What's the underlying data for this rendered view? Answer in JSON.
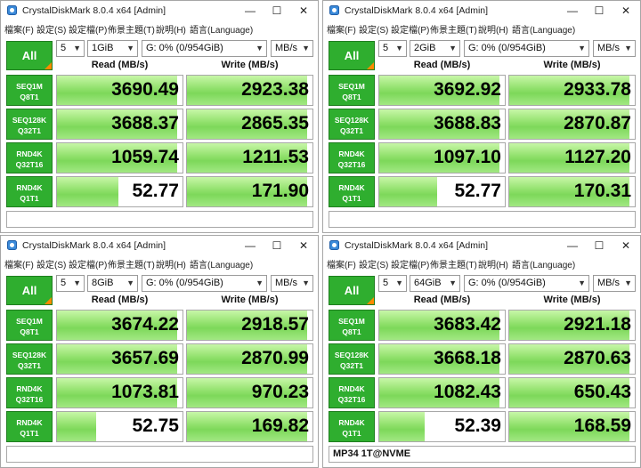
{
  "app_title": "CrystalDiskMark 8.0.4 x64 [Admin]",
  "menu": [
    "檔案(F)",
    "設定(S)",
    "設定檔(P)",
    "佈景主題(T)",
    "說明(H)",
    "語言(Language)"
  ],
  "window_controls": {
    "minimize": "—",
    "maximize": "☐",
    "close": "✕"
  },
  "all_button": "All",
  "headers": {
    "read": "Read (MB/s)",
    "write": "Write (MB/s)"
  },
  "colors": {
    "accent_green": "#2fae2f",
    "bar_green": "#8fe06a",
    "corner_orange": "#ff8a00"
  },
  "row_labels": [
    {
      "line1": "SEQ1M",
      "line2": "Q8T1"
    },
    {
      "line1": "SEQ128K",
      "line2": "Q32T1"
    },
    {
      "line1": "RND4K",
      "line2": "Q32T16"
    },
    {
      "line1": "RND4K",
      "line2": "Q1T1"
    }
  ],
  "windows": [
    {
      "count": "5",
      "size": "1GiB",
      "drive": "G: 0% (0/954GiB)",
      "unit": "MB/s",
      "status": "",
      "results": [
        {
          "read": "3690.49",
          "write": "2923.38",
          "read_fill": 0.96,
          "write_fill": 0.96
        },
        {
          "read": "3688.37",
          "write": "2865.35",
          "read_fill": 0.96,
          "write_fill": 0.96
        },
        {
          "read": "1059.74",
          "write": "1211.53",
          "read_fill": 0.96,
          "write_fill": 0.96
        },
        {
          "read": "52.77",
          "write": "171.90",
          "read_fill": 0.49,
          "write_fill": 0.96
        }
      ]
    },
    {
      "count": "5",
      "size": "2GiB",
      "drive": "G: 0% (0/954GiB)",
      "unit": "MB/s",
      "status": "",
      "results": [
        {
          "read": "3692.92",
          "write": "2933.78",
          "read_fill": 0.96,
          "write_fill": 0.96
        },
        {
          "read": "3688.83",
          "write": "2870.87",
          "read_fill": 0.96,
          "write_fill": 0.96
        },
        {
          "read": "1097.10",
          "write": "1127.20",
          "read_fill": 0.96,
          "write_fill": 0.96
        },
        {
          "read": "52.77",
          "write": "170.31",
          "read_fill": 0.46,
          "write_fill": 0.96
        }
      ]
    },
    {
      "count": "5",
      "size": "8GiB",
      "drive": "G: 0% (0/954GiB)",
      "unit": "MB/s",
      "status": "",
      "results": [
        {
          "read": "3674.22",
          "write": "2918.57",
          "read_fill": 0.96,
          "write_fill": 0.96
        },
        {
          "read": "3657.69",
          "write": "2870.99",
          "read_fill": 0.96,
          "write_fill": 0.96
        },
        {
          "read": "1073.81",
          "write": "970.23",
          "read_fill": 0.96,
          "write_fill": 0.96
        },
        {
          "read": "52.75",
          "write": "169.82",
          "read_fill": 0.31,
          "write_fill": 0.96
        }
      ]
    },
    {
      "count": "5",
      "size": "64GiB",
      "drive": "G: 0% (0/954GiB)",
      "unit": "MB/s",
      "status": "MP34 1T@NVME",
      "results": [
        {
          "read": "3683.42",
          "write": "2921.18",
          "read_fill": 0.96,
          "write_fill": 0.96
        },
        {
          "read": "3668.18",
          "write": "2870.63",
          "read_fill": 0.96,
          "write_fill": 0.96
        },
        {
          "read": "1082.43",
          "write": "650.43",
          "read_fill": 0.96,
          "write_fill": 0.96
        },
        {
          "read": "52.39",
          "write": "168.59",
          "read_fill": 0.36,
          "write_fill": 0.96
        }
      ]
    }
  ]
}
